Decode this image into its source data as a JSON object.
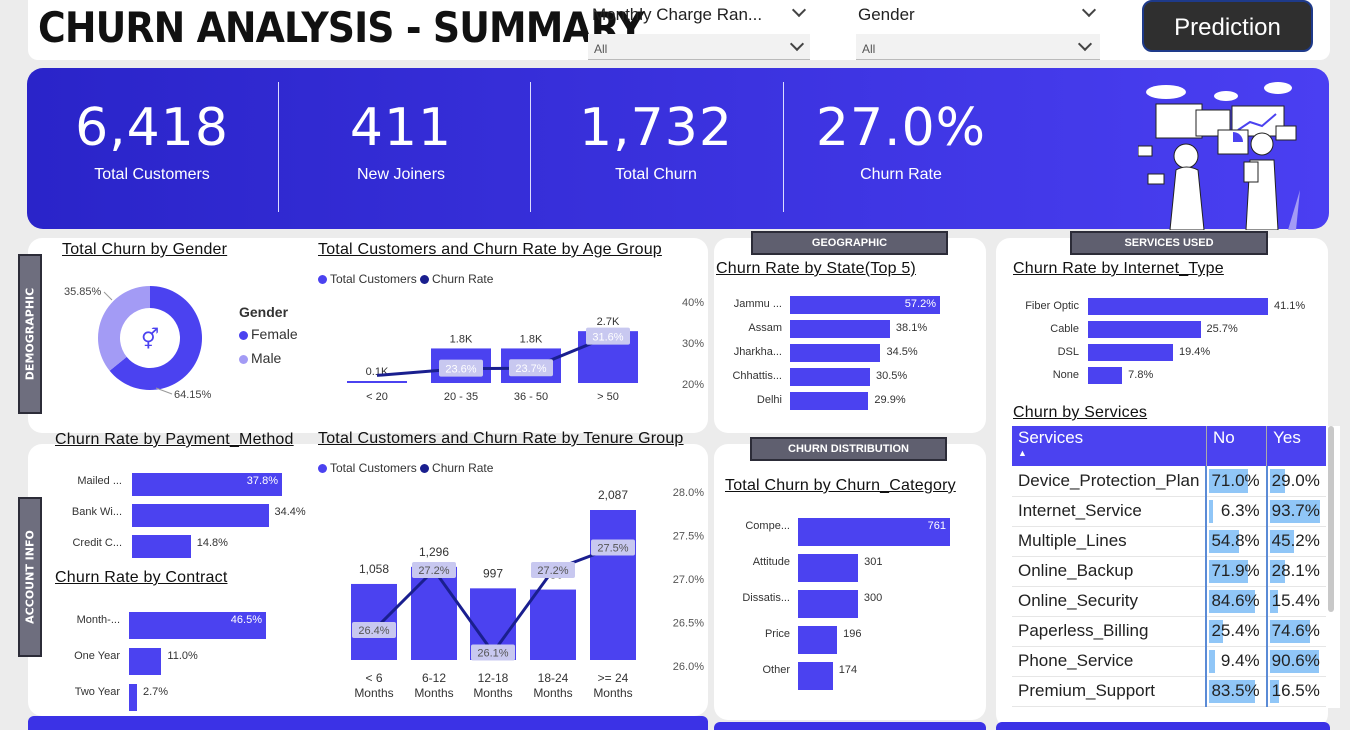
{
  "header": {
    "title": "CHURN ANALYSIS - SUMMARY",
    "prediction_label": "Prediction"
  },
  "filters": [
    {
      "label": "Monthly Charge Ran...",
      "value": "All"
    },
    {
      "label": "Gender",
      "value": "All"
    }
  ],
  "kpis": [
    {
      "value": "6,418",
      "label": "Total Customers"
    },
    {
      "value": "411",
      "label": "New Joiners"
    },
    {
      "value": "1,732",
      "label": "Total Churn"
    },
    {
      "value": "27.0%",
      "label": "Churn Rate"
    }
  ],
  "sections": {
    "demographic": "DEMOGRAPHIC",
    "account": "ACCOUNT INFO",
    "geographic": "GEOGRAPHIC",
    "churn_dist": "CHURN DISTRIBUTION",
    "services_used": "SERVICES USED"
  },
  "gender_chart": {
    "title": "Total Churn by Gender",
    "legend_title": "Gender",
    "slices": [
      {
        "name": "Female",
        "pct": 64.15,
        "label": "64.15%",
        "color": "#4b42f0"
      },
      {
        "name": "Male",
        "pct": 35.85,
        "label": "35.85%",
        "color": "#a39bf5"
      }
    ]
  },
  "age_chart": {
    "title": "Total Customers and Churn Rate by Age Group",
    "legend": [
      "Total Customers",
      "Churn Rate"
    ],
    "categories": [
      "< 20",
      "20 - 35",
      "36 - 50",
      "> 50"
    ],
    "customers": [
      "0.1K",
      "1.8K",
      "1.8K",
      "2.7K"
    ],
    "customer_values": [
      0.1,
      1.8,
      1.8,
      2.7
    ],
    "rates": [
      "",
      "23.6%",
      "23.7%",
      "31.6%"
    ],
    "rate_values": [
      21.9,
      23.6,
      23.7,
      31.6
    ],
    "y2_ticks": [
      "40%",
      "30%",
      "20%"
    ]
  },
  "state_chart": {
    "title": "Churn Rate by State(Top 5)",
    "rows": [
      {
        "name": "Jammu ...",
        "value": 57.2,
        "label": "57.2%"
      },
      {
        "name": "Assam",
        "value": 38.1,
        "label": "38.1%"
      },
      {
        "name": "Jharkha...",
        "value": 34.5,
        "label": "34.5%"
      },
      {
        "name": "Chhattis...",
        "value": 30.5,
        "label": "30.5%"
      },
      {
        "name": "Delhi",
        "value": 29.9,
        "label": "29.9%"
      }
    ]
  },
  "internet_chart": {
    "title": "Churn Rate by Internet_Type",
    "rows": [
      {
        "name": "Fiber Optic",
        "value": 41.1,
        "label": "41.1%"
      },
      {
        "name": "Cable",
        "value": 25.7,
        "label": "25.7%"
      },
      {
        "name": "DSL",
        "value": 19.4,
        "label": "19.4%"
      },
      {
        "name": "None",
        "value": 7.8,
        "label": "7.8%"
      }
    ]
  },
  "payment_chart": {
    "title": "Churn Rate by Payment_Method",
    "rows": [
      {
        "name": "Mailed ...",
        "value": 37.8,
        "label": "37.8%"
      },
      {
        "name": "Bank Wi...",
        "value": 34.4,
        "label": "34.4%"
      },
      {
        "name": "Credit C...",
        "value": 14.8,
        "label": "14.8%"
      }
    ]
  },
  "contract_chart": {
    "title": "Churn Rate by Contract",
    "rows": [
      {
        "name": "Month-...",
        "value": 46.5,
        "label": "46.5%"
      },
      {
        "name": "One Year",
        "value": 11.0,
        "label": "11.0%"
      },
      {
        "name": "Two Year",
        "value": 2.7,
        "label": "2.7%"
      }
    ]
  },
  "tenure_chart": {
    "title": "Total Customers and Churn Rate by Tenure Group",
    "legend": [
      "Total Customers",
      "Churn Rate"
    ],
    "categories": [
      [
        "< 6",
        "Months"
      ],
      [
        "6-12",
        "Months"
      ],
      [
        "12-18",
        "Months"
      ],
      [
        "18-24",
        "Months"
      ],
      [
        ">= 24",
        "Months"
      ]
    ],
    "customers": [
      "1,058",
      "1,296",
      "997",
      "980",
      "2,087"
    ],
    "customer_values": [
      1058,
      1296,
      997,
      980,
      2087
    ],
    "rates": [
      "26.4%",
      "27.2%",
      "26.1%",
      "27.2%",
      "27.5%"
    ],
    "rate_values": [
      26.4,
      27.2,
      26.1,
      27.2,
      27.5
    ],
    "y2_ticks": [
      "28.0%",
      "27.5%",
      "27.0%",
      "26.5%",
      "26.0%"
    ]
  },
  "category_chart": {
    "title": "Total Churn by Churn_Category",
    "rows": [
      {
        "name": "Compe...",
        "value": 761,
        "label": "761"
      },
      {
        "name": "Attitude",
        "value": 301,
        "label": "301"
      },
      {
        "name": "Dissatis...",
        "value": 300,
        "label": "300"
      },
      {
        "name": "Price",
        "value": 196,
        "label": "196"
      },
      {
        "name": "Other",
        "value": 174,
        "label": "174"
      }
    ]
  },
  "services_table": {
    "title": "Churn by Services",
    "headers": [
      "Services",
      "No",
      "Yes"
    ],
    "rows": [
      {
        "name": "Device_Protection_Plan",
        "no": "71.0%",
        "yes": "29.0%",
        "no_v": 71.0,
        "yes_v": 29.0
      },
      {
        "name": "Internet_Service",
        "no": "6.3%",
        "yes": "93.7%",
        "no_v": 6.3,
        "yes_v": 93.7
      },
      {
        "name": "Multiple_Lines",
        "no": "54.8%",
        "yes": "45.2%",
        "no_v": 54.8,
        "yes_v": 45.2
      },
      {
        "name": "Online_Backup",
        "no": "71.9%",
        "yes": "28.1%",
        "no_v": 71.9,
        "yes_v": 28.1
      },
      {
        "name": "Online_Security",
        "no": "84.6%",
        "yes": "15.4%",
        "no_v": 84.6,
        "yes_v": 15.4
      },
      {
        "name": "Paperless_Billing",
        "no": "25.4%",
        "yes": "74.6%",
        "no_v": 25.4,
        "yes_v": 74.6
      },
      {
        "name": "Phone_Service",
        "no": "9.4%",
        "yes": "90.6%",
        "no_v": 9.4,
        "yes_v": 90.6
      },
      {
        "name": "Premium_Support",
        "no": "83.5%",
        "yes": "16.5%",
        "no_v": 83.5,
        "yes_v": 16.5
      }
    ]
  },
  "colors": {
    "primary": "#4b42f0",
    "dark_line": "#1a1f8f",
    "light": "#a39bf5",
    "banner": "#3b32e6",
    "table_header": "#4b42f0",
    "cell_bar": "#90c6f7"
  }
}
